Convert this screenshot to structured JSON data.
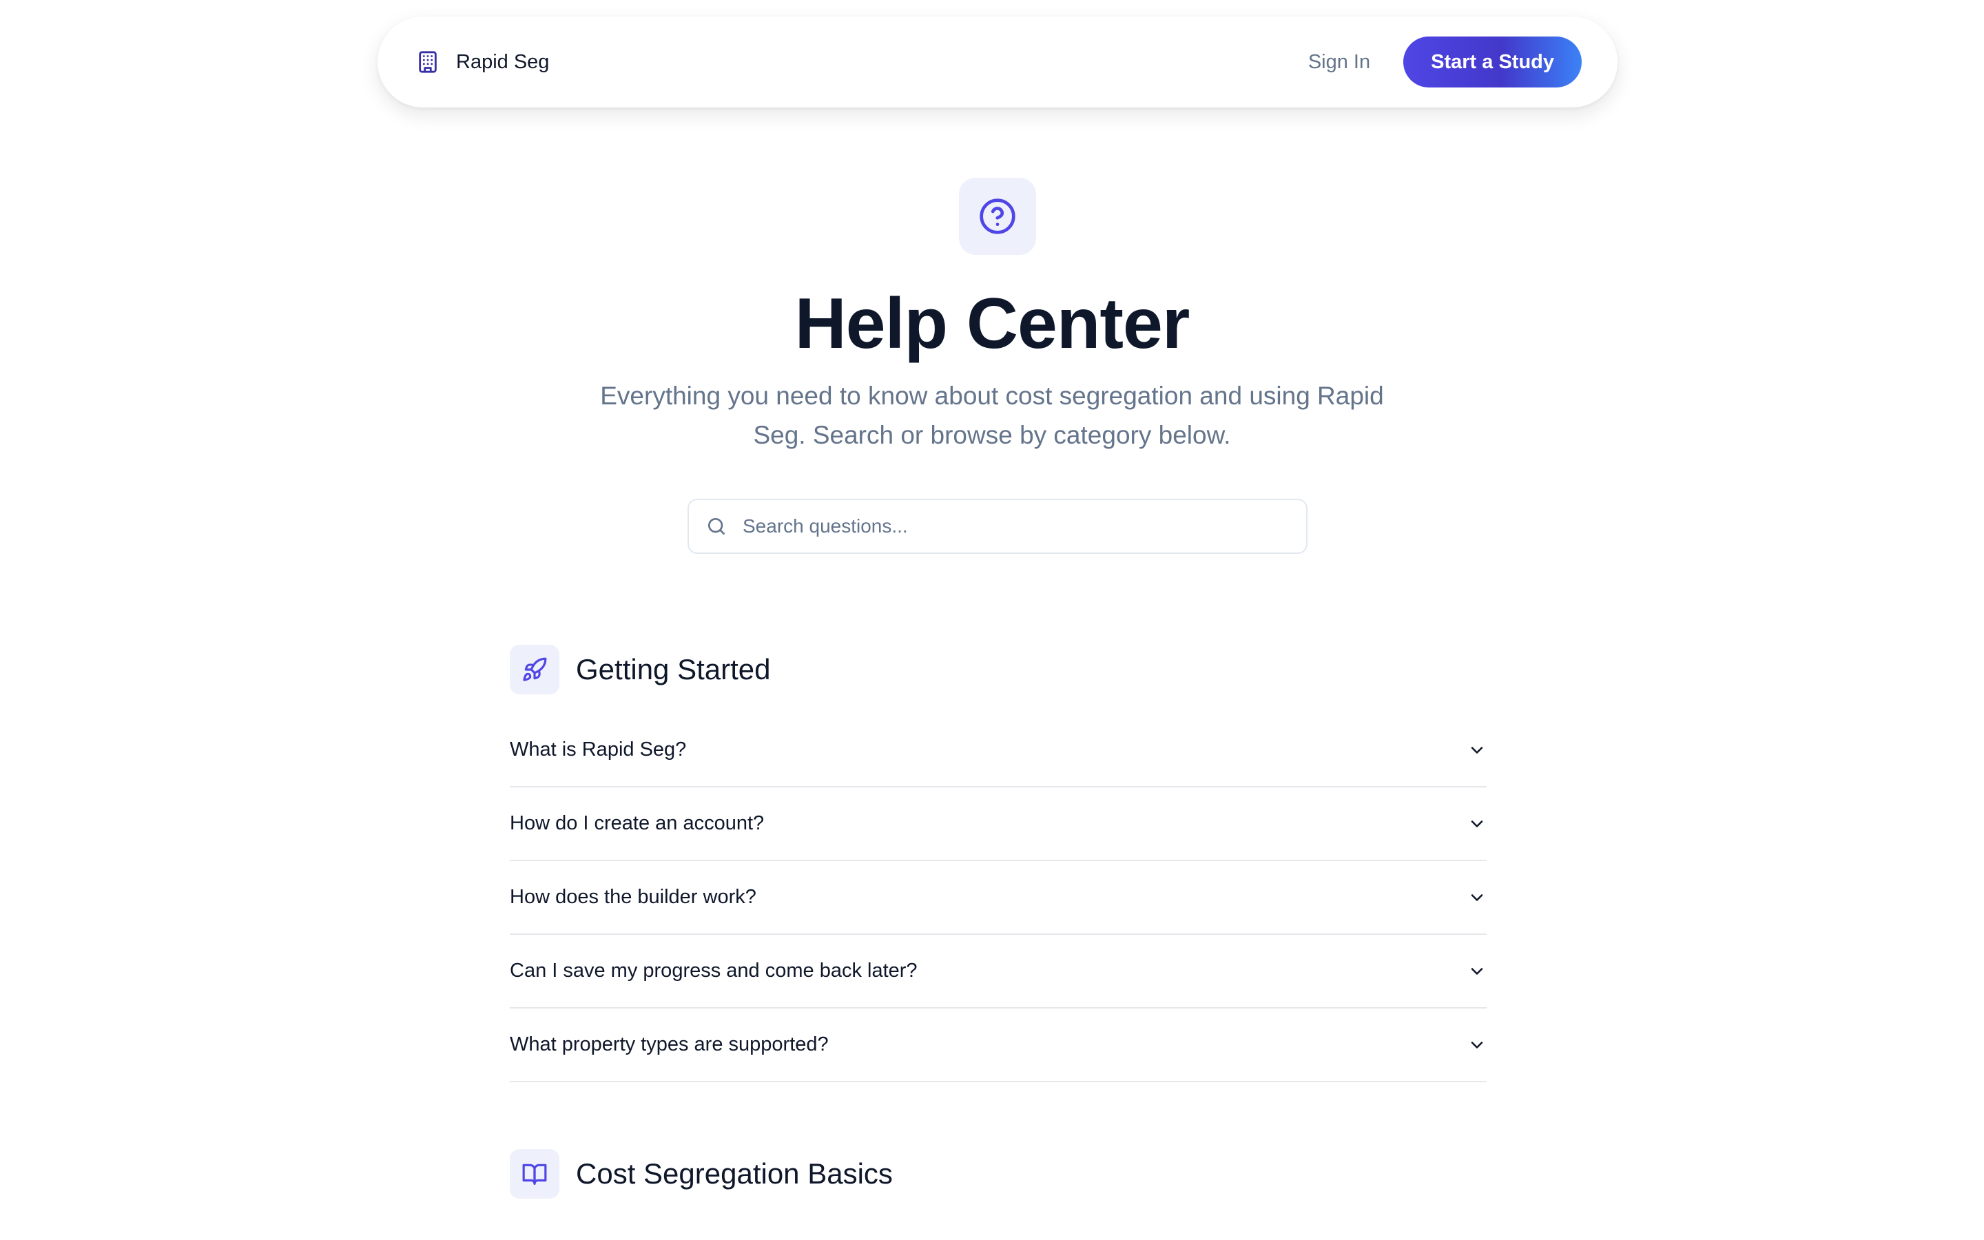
{
  "nav": {
    "brand": "Rapid Seg",
    "sign_in": "Sign In",
    "cta": "Start a Study"
  },
  "hero": {
    "icon": "question-circle-icon",
    "title": "Help Center",
    "subtitle": "Everything you need to know about cost segregation and using Rapid Seg. Search or browse by category below."
  },
  "search": {
    "placeholder": "Search questions...",
    "value": ""
  },
  "sections": [
    {
      "icon": "rocket-icon",
      "title": "Getting Started",
      "questions": [
        "What is Rapid Seg?",
        "How do I create an account?",
        "How does the builder work?",
        "Can I save my progress and come back later?",
        "What property types are supported?"
      ]
    },
    {
      "icon": "book-open-icon",
      "title": "Cost Segregation Basics",
      "questions": []
    }
  ],
  "colors": {
    "accent": "#4f46e5",
    "accent_gradient_end": "#3b82f6",
    "icon_bg": "#eef0fb",
    "text_primary": "#0f172a",
    "text_muted": "#64748b",
    "divider": "#e5e7eb"
  }
}
